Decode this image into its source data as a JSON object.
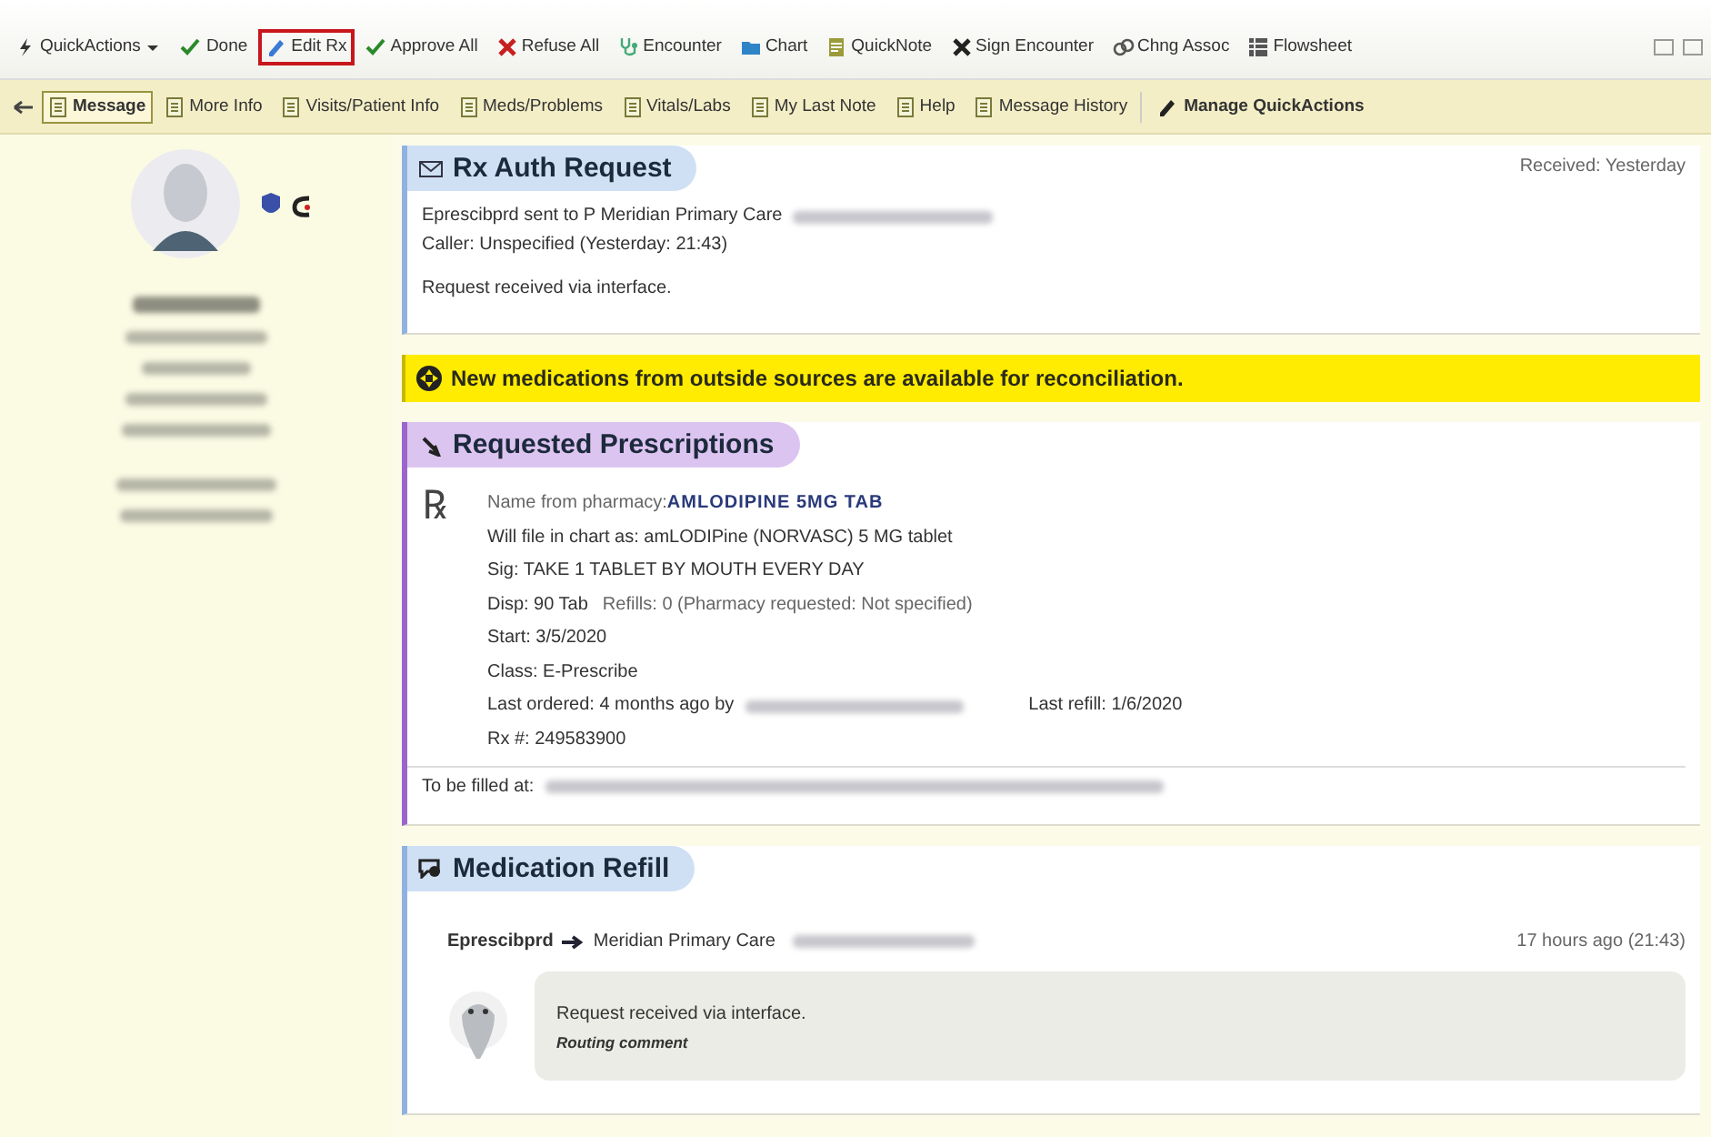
{
  "toolbar": [
    {
      "label": "QuickActions",
      "dropdown": true,
      "highlighted": false
    },
    {
      "label": "Done",
      "dropdown": false,
      "highlighted": false
    },
    {
      "label": "Edit Rx",
      "dropdown": false,
      "highlighted": true
    },
    {
      "label": "Approve All",
      "dropdown": false,
      "highlighted": false
    },
    {
      "label": "Refuse All",
      "dropdown": false,
      "highlighted": false
    },
    {
      "label": "Encounter",
      "dropdown": false,
      "highlighted": false
    },
    {
      "label": "Chart",
      "dropdown": false,
      "highlighted": false
    },
    {
      "label": "QuickNote",
      "dropdown": false,
      "highlighted": false
    },
    {
      "label": "Sign Encounter",
      "dropdown": false,
      "highlighted": false
    },
    {
      "label": "Chng Assoc",
      "dropdown": false,
      "highlighted": false
    },
    {
      "label": "Flowsheet",
      "dropdown": false,
      "highlighted": false
    }
  ],
  "tabs": [
    {
      "label": "Message",
      "selected": true
    },
    {
      "label": "More Info",
      "selected": false
    },
    {
      "label": "Visits/Patient Info",
      "selected": false
    },
    {
      "label": "Meds/Problems",
      "selected": false
    },
    {
      "label": "Vitals/Labs",
      "selected": false
    },
    {
      "label": "My Last Note",
      "selected": false
    },
    {
      "label": "Help",
      "selected": false
    },
    {
      "label": "Message History",
      "selected": false
    }
  ],
  "manage_button": "Manage QuickActions",
  "sidebar": {
    "patient_lines": [
      {
        "kind": "redacted",
        "bold": true
      },
      {
        "kind": "redacted",
        "bold": false
      },
      {
        "kind": "redacted",
        "bold": false
      },
      {
        "kind": "redacted",
        "bold": false
      },
      {
        "kind": "redacted",
        "bold": false
      },
      {
        "kind": "redacted",
        "bold": false
      },
      {
        "kind": "redacted",
        "bold": false
      }
    ]
  },
  "auth_request": {
    "title": "Rx Auth Request",
    "received": "Received: Yesterday",
    "sent_line": "Eprescibprd sent to P Meridian Primary Care",
    "sent_redacted": true,
    "caller": "Caller: Unspecified (Yesterday: 21:43)",
    "note": "Request received via interface."
  },
  "banner": "New medications from outside sources are available for reconciliation.",
  "prescriptions": {
    "title": "Requested Prescriptions",
    "rx_symbol": "℞",
    "name_label": "Name from pharmacy:",
    "name_value": "AMLODIPINE  5MG  TAB",
    "file_as": "Will file in chart as: amLODIPine (NORVASC) 5 MG tablet",
    "sig": "Sig: TAKE 1 TABLET BY MOUTH  EVERY DAY",
    "disp": "Disp: 90 Tab",
    "refills": "Refills: 0 (Pharmacy requested: Not specified)",
    "start": "Start: 3/5/2020",
    "class": "Class: E-Prescribe",
    "last_ordered": "Last ordered: 4 months ago by",
    "last_ordered_redacted": true,
    "last_refill": "Last refill: 1/6/2020",
    "rx_number": "Rx #: 249583900",
    "filled_at": "To be filled at:",
    "filled_at_redacted": true
  },
  "refill": {
    "title": "Medication Refill",
    "from": "Eprescibprd",
    "to": "Meridian Primary Care",
    "to_redacted": true,
    "time": "17 hours ago (21:43)",
    "comment": "Request received via interface.",
    "comment_label": "Routing comment"
  }
}
